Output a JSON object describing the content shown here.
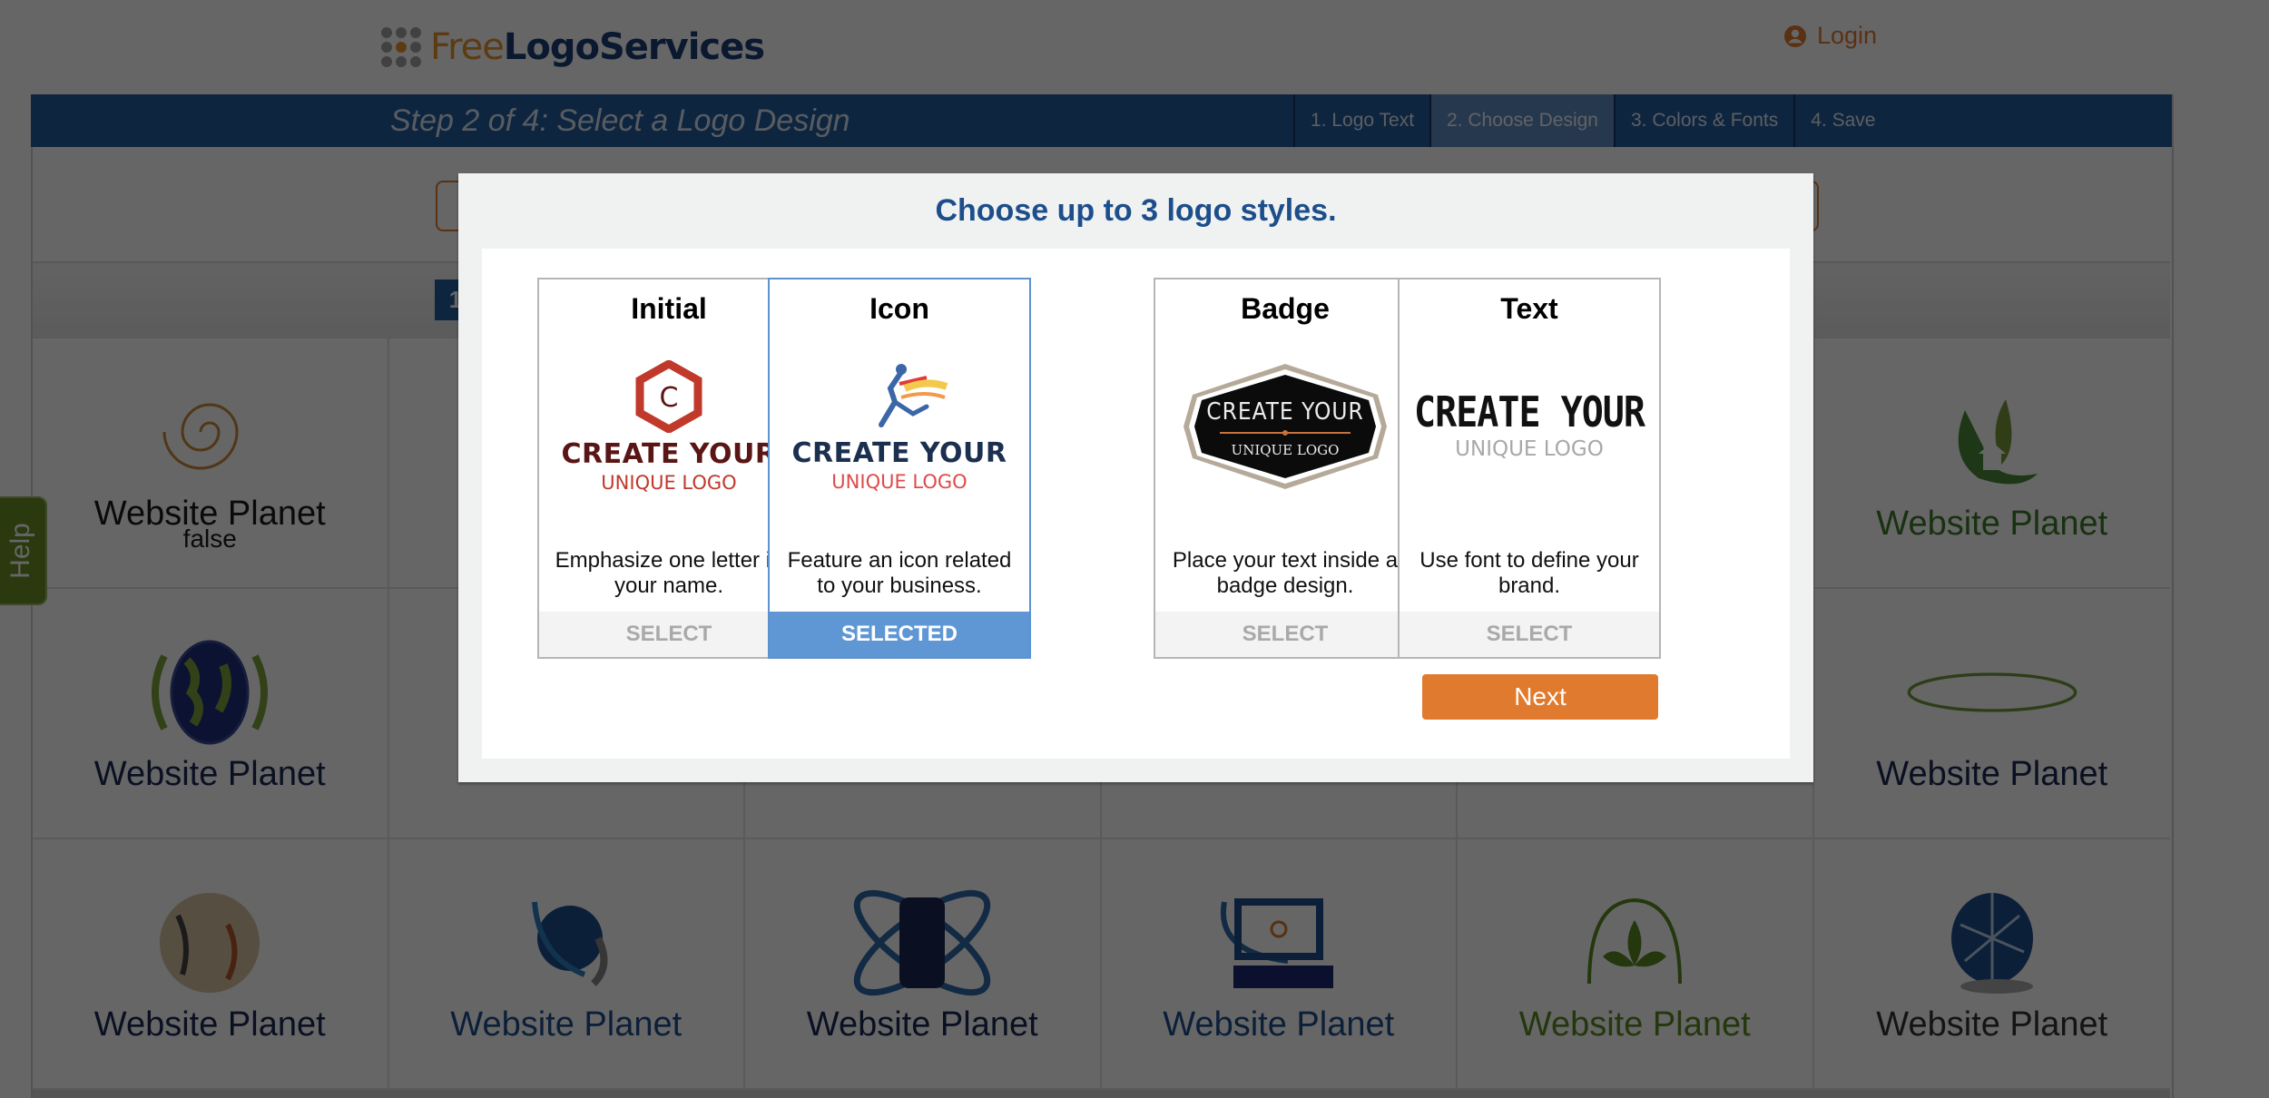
{
  "header": {
    "brand_part1": "Free",
    "brand_part2": "LogoServices",
    "login_label": "Login",
    "login_icon": "user-circle-icon"
  },
  "wizard": {
    "step_title": "Step 2 of 4: Select a Logo Design",
    "steps": [
      {
        "label": "1. Logo Text",
        "active": false
      },
      {
        "label": "2. Choose Design",
        "active": true
      },
      {
        "label": "3. Colors & Fonts",
        "active": false
      },
      {
        "label": "4. Save",
        "active": false
      }
    ],
    "current_page": "1"
  },
  "help_tab": {
    "label": "Help"
  },
  "logo_grid": {
    "rows": [
      [
        {
          "name": "Website Planet",
          "sub": "false",
          "art": "spiral-icon",
          "color": "#1a1a1a"
        },
        {
          "name": "",
          "art": ""
        },
        {
          "name": "",
          "art": ""
        },
        {
          "name": "",
          "art": ""
        },
        {
          "name": "",
          "art": ""
        },
        {
          "name": "Website Planet",
          "art": "leaf-house-icon",
          "color": "#3d7a2c"
        }
      ],
      [
        {
          "name": "Website Planet",
          "art": "globe-rings-icon",
          "color": "#1b2a55"
        },
        {
          "name": "",
          "art": ""
        },
        {
          "name": "",
          "art": ""
        },
        {
          "name": "",
          "art": ""
        },
        {
          "name": "",
          "art": ""
        },
        {
          "name": "Website Planet",
          "art": "orbit-swoosh-icon",
          "color": "#1b2a55"
        }
      ],
      [
        {
          "name": "Website Planet",
          "art": "antique-globe-icon",
          "color": "#1b2a55"
        },
        {
          "name": "Website Planet",
          "art": "swoosh-globe-icon",
          "color": "#1f4f8f"
        },
        {
          "name": "Website Planet",
          "art": "team-orbit-icon",
          "color": "#1b2a55"
        },
        {
          "name": "Website Planet",
          "art": "computer-power-icon",
          "color": "#1f4f8f"
        },
        {
          "name": "Website Planet",
          "art": "leaf-arch-icon",
          "color": "#5a8a22"
        },
        {
          "name": "Website Planet",
          "art": "network-globe-icon",
          "color": "#333333"
        }
      ]
    ]
  },
  "modal": {
    "title": "Choose up to 3 logo styles.",
    "cards": [
      {
        "title": "Initial",
        "preview_line1": "CREATE YOUR",
        "preview_line2": "UNIQUE LOGO",
        "preview_letter": "C",
        "description": "Emphasize one letter in your name.",
        "button": "SELECT",
        "selected": false
      },
      {
        "title": "Icon",
        "preview_line1": "CREATE YOUR",
        "preview_line2": "UNIQUE LOGO",
        "description": "Feature an icon related to your business.",
        "button": "SELECTED",
        "selected": true
      },
      {
        "title": "Badge",
        "preview_line1": "CREATE YOUR",
        "preview_line2": "UNIQUE LOGO",
        "description": "Place your text inside a badge design.",
        "button": "SELECT",
        "selected": false
      },
      {
        "title": "Text",
        "preview_line1": "CREATE YOUR",
        "preview_line2": "UNIQUE LOGO",
        "description": "Use font to define your brand.",
        "button": "SELECT",
        "selected": false
      }
    ],
    "next_label": "Next"
  },
  "colors": {
    "accent_orange": "#e07a2e",
    "nav_blue": "#255ca0",
    "title_blue": "#1d4e8c",
    "selected_blue": "#5f97d4",
    "help_green": "#6b8e23"
  }
}
